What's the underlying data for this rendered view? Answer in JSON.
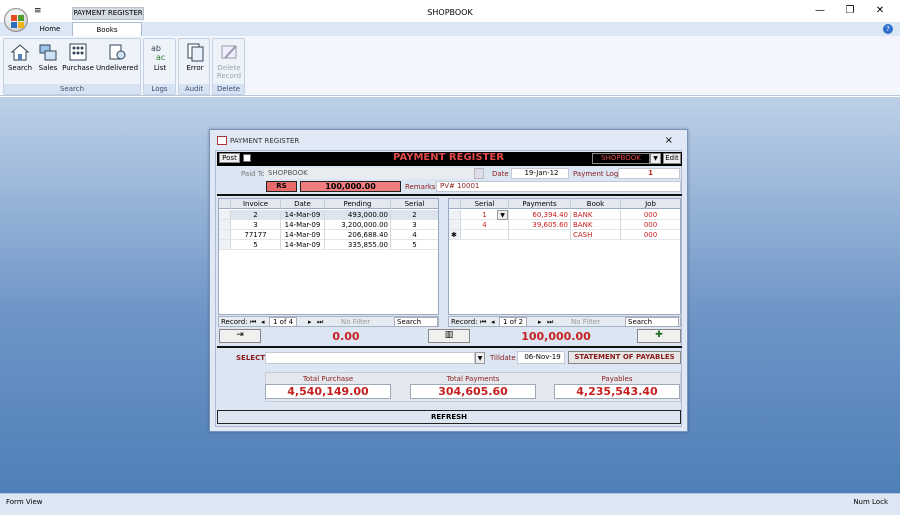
{
  "app": {
    "title": "SHOPBOOK",
    "context_tab": "PAYMENT REGISTER",
    "qat": "≡",
    "minimize": "—",
    "restore": "❐",
    "close": "✕",
    "help": "?"
  },
  "tabs": [
    {
      "label": "Home"
    },
    {
      "label": "Books"
    }
  ],
  "ribbon": {
    "groups": [
      {
        "label": "Search"
      },
      {
        "label": "Logs"
      },
      {
        "label": "Audit"
      },
      {
        "label": "Delete"
      }
    ],
    "buttons": [
      {
        "label": "Search",
        "icon": "search-icon"
      },
      {
        "label": "Sales",
        "icon": "sales-icon"
      },
      {
        "label": "Purchase",
        "icon": "purchase-icon"
      },
      {
        "label": "Undelivered",
        "icon": "undelivered-icon"
      },
      {
        "label": "List",
        "icon": "list-icon"
      },
      {
        "label": "Error",
        "icon": "error-icon"
      },
      {
        "label": "Delete",
        "label2": "Record",
        "icon": "delete-record-icon"
      }
    ]
  },
  "status": {
    "left": "Form View",
    "right": "Num Lock"
  },
  "dialog": {
    "title": "PAYMENT REGISTER",
    "close": "×",
    "post": "Post",
    "heading": "PAYMENT REGISTER",
    "book_select": "SHOPBOOK",
    "edit": "Edit",
    "paid_to_label": "Paid To",
    "paid_to": "SHOPBOOK",
    "date_label": "Date",
    "date": "19-Jan-12",
    "payment_log_label": "Payment Log",
    "payment_log": "1",
    "currency": "RS",
    "amount": "100,000.00",
    "remarks_label": "Remarks",
    "remarks": "PV# 10001",
    "left_grid": {
      "headers": [
        "Invoice",
        "Date",
        "Pending",
        "Serial"
      ],
      "rows": [
        [
          "2",
          "14-Mar-09",
          "493,000.00",
          "2"
        ],
        [
          "3",
          "14-Mar-09",
          "3,200,000.00",
          "3"
        ],
        [
          "77177",
          "14-Mar-09",
          "206,688.40",
          "4"
        ],
        [
          "5",
          "14-Mar-09",
          "335,855.00",
          "5"
        ]
      ],
      "nav": {
        "record_label": "Record:",
        "position": "1 of 4",
        "filter": "No Filter",
        "search": "Search"
      }
    },
    "right_grid": {
      "headers": [
        "Serial",
        "Payments",
        "Book",
        "Job"
      ],
      "rows": [
        [
          "1",
          "60,394.40",
          "BANK",
          "000"
        ],
        [
          "4",
          "39,605.60",
          "BANK",
          "000"
        ],
        [
          "",
          "",
          "CASH",
          "000"
        ]
      ],
      "new_row_marker": "✱",
      "nav": {
        "record_label": "Record:",
        "position": "1 of 2",
        "filter": "No Filter",
        "search": "Search"
      }
    },
    "left_total": "0.00",
    "right_total": "100,000.00",
    "select_label": "SELECT",
    "select_value": "",
    "tilldate_label": "Tilldate",
    "tilldate": "06-Nov-19",
    "statement_button": "STATEMENT OF PAYABLES",
    "totals": [
      {
        "label": "Total Purchase",
        "value": "4,540,149.00"
      },
      {
        "label": "Total Payments",
        "value": "304,605.60"
      },
      {
        "label": "Payables",
        "value": "4,235,543.40"
      }
    ],
    "refresh": "REFRESH"
  },
  "colors": {
    "accent_red": "#c62020",
    "workspace_top": "#bdd0e8",
    "workspace_bottom": "#4f7fb8"
  }
}
